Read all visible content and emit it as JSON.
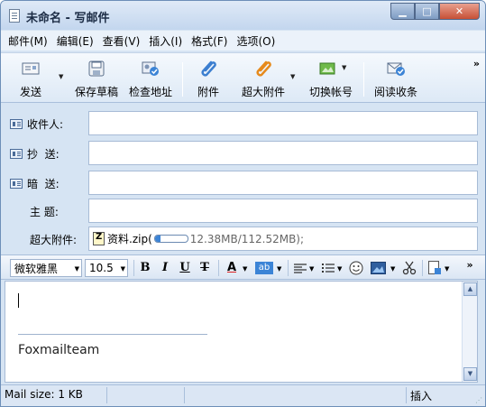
{
  "window": {
    "title": "未命名 - 写邮件",
    "min_label": "▁",
    "max_label": "□",
    "close_label": "✕"
  },
  "menu": [
    "邮件(M)",
    "编辑(E)",
    "查看(V)",
    "插入(I)",
    "格式(F)",
    "选项(O)"
  ],
  "toolbar": {
    "send": "发送",
    "save_draft": "保存草稿",
    "check_address": "检查地址",
    "attach": "附件",
    "big_attach": "超大附件",
    "switch_account": "切换帐号",
    "read_receipt": "阅读收条",
    "more": "»"
  },
  "fields": {
    "to_label": "收件人:",
    "cc_label": "抄  送:",
    "bcc_label": "暗  送:",
    "subject_label": "主  题:",
    "big_attach_label": "超大附件:",
    "to_value": "",
    "cc_value": "",
    "bcc_value": "",
    "subject_value": ""
  },
  "attachment": {
    "filename": "资料.zip(",
    "progress_fraction": 0.16,
    "size": " 12.38MB/112.52MB);"
  },
  "format": {
    "font": "微软雅黑",
    "size": "10.5",
    "bold": "B",
    "italic": "I",
    "underline": "U",
    "strike": "T",
    "font_color": "A",
    "highlight": "ab",
    "more": "»"
  },
  "editor": {
    "signature": "Foxmailteam"
  },
  "status": {
    "mail_size": "Mail size: 1 KB",
    "insert_mode": "插入"
  },
  "colors": {
    "accent": "#3c84d6",
    "chrome": "#d6e4f3"
  }
}
